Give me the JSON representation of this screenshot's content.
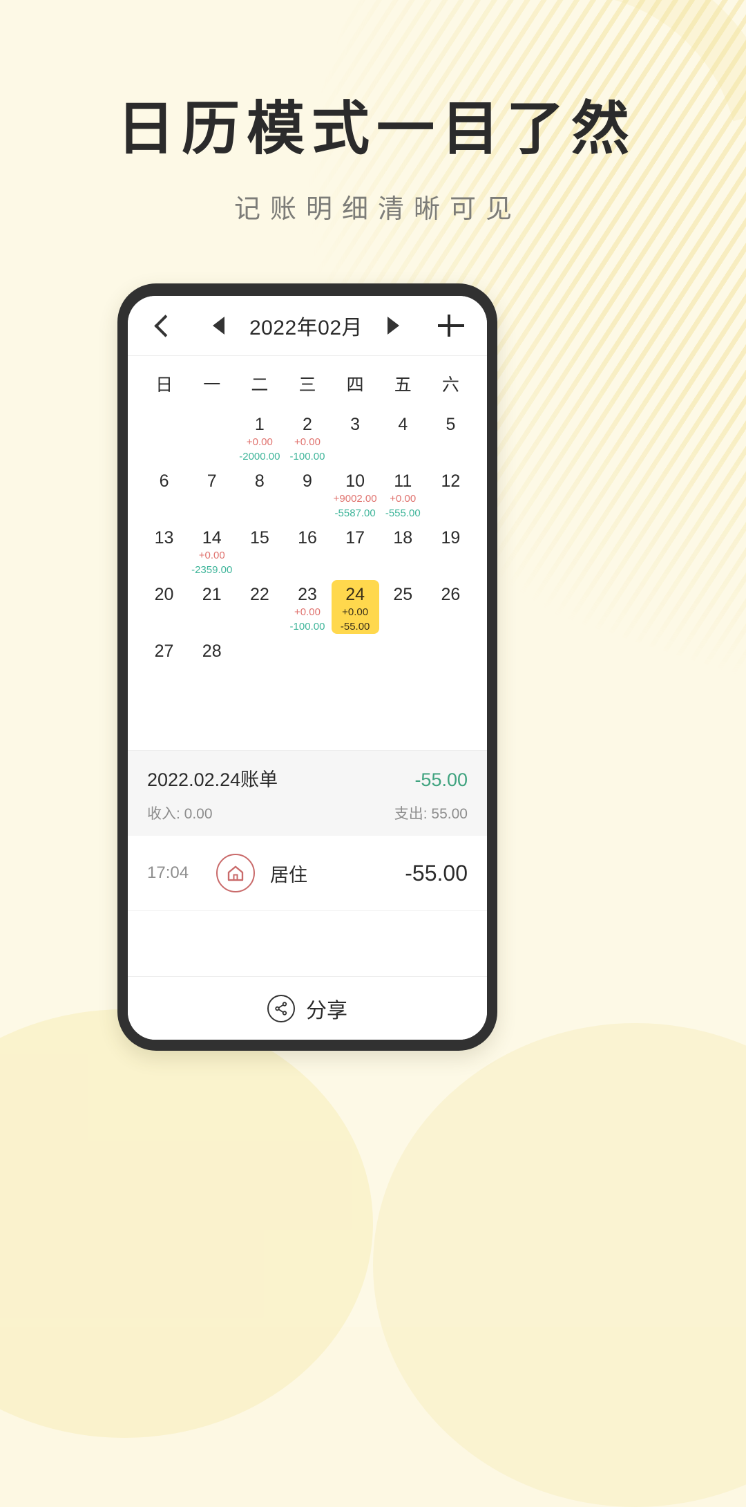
{
  "promo": {
    "headline": "日历模式一目了然",
    "subhead": "记账明细清晰可见"
  },
  "theme": {
    "page_bg": "#fdf9e6",
    "stripe": "#f3e4a0",
    "selected_day_bg": "#ffd84d",
    "income_color": "#e0736f",
    "expense_color": "#3fb59a",
    "total_color": "#3fa37f"
  },
  "app": {
    "header": {
      "back_icon": "chevron-left-icon",
      "prev_icon": "triangle-left-icon",
      "month_label": "2022年02月",
      "next_icon": "triangle-right-icon",
      "add_icon": "plus-icon"
    },
    "weekdays": [
      "日",
      "一",
      "二",
      "三",
      "四",
      "五",
      "六"
    ],
    "calendar": {
      "lead_blanks": 2,
      "days": [
        {
          "num": "1",
          "income": "+0.00",
          "expense": "-2000.00",
          "selected": false
        },
        {
          "num": "2",
          "income": "+0.00",
          "expense": "-100.00",
          "selected": false
        },
        {
          "num": "3",
          "income": "",
          "expense": "",
          "selected": false
        },
        {
          "num": "4",
          "income": "",
          "expense": "",
          "selected": false
        },
        {
          "num": "5",
          "income": "",
          "expense": "",
          "selected": false
        },
        {
          "num": "6",
          "income": "",
          "expense": "",
          "selected": false
        },
        {
          "num": "7",
          "income": "",
          "expense": "",
          "selected": false
        },
        {
          "num": "8",
          "income": "",
          "expense": "",
          "selected": false
        },
        {
          "num": "9",
          "income": "",
          "expense": "",
          "selected": false
        },
        {
          "num": "10",
          "income": "+9002.00",
          "expense": "-5587.00",
          "selected": false
        },
        {
          "num": "11",
          "income": "+0.00",
          "expense": "-555.00",
          "selected": false
        },
        {
          "num": "12",
          "income": "",
          "expense": "",
          "selected": false
        },
        {
          "num": "13",
          "income": "",
          "expense": "",
          "selected": false
        },
        {
          "num": "14",
          "income": "+0.00",
          "expense": "-2359.00",
          "selected": false
        },
        {
          "num": "15",
          "income": "",
          "expense": "",
          "selected": false
        },
        {
          "num": "16",
          "income": "",
          "expense": "",
          "selected": false
        },
        {
          "num": "17",
          "income": "",
          "expense": "",
          "selected": false
        },
        {
          "num": "18",
          "income": "",
          "expense": "",
          "selected": false
        },
        {
          "num": "19",
          "income": "",
          "expense": "",
          "selected": false
        },
        {
          "num": "20",
          "income": "",
          "expense": "",
          "selected": false
        },
        {
          "num": "21",
          "income": "",
          "expense": "",
          "selected": false
        },
        {
          "num": "22",
          "income": "",
          "expense": "",
          "selected": false
        },
        {
          "num": "23",
          "income": "+0.00",
          "expense": "-100.00",
          "selected": false
        },
        {
          "num": "24",
          "income": "+0.00",
          "expense": "-55.00",
          "selected": true
        },
        {
          "num": "25",
          "income": "",
          "expense": "",
          "selected": false
        },
        {
          "num": "26",
          "income": "",
          "expense": "",
          "selected": false
        },
        {
          "num": "27",
          "income": "",
          "expense": "",
          "selected": false
        },
        {
          "num": "28",
          "income": "",
          "expense": "",
          "selected": false
        }
      ]
    },
    "summary": {
      "title": "2022.02.24账单",
      "total": "-55.00",
      "income_label": "收入: 0.00",
      "expense_label": "支出: 55.00"
    },
    "transactions": [
      {
        "time": "17:04",
        "icon": "house-icon",
        "category": "居住",
        "amount": "-55.00"
      }
    ],
    "share": {
      "icon": "share-icon",
      "label": "分享"
    }
  }
}
